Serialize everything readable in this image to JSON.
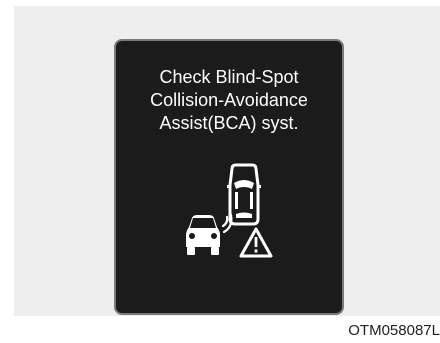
{
  "display": {
    "message_lines": [
      "Check Blind-Spot",
      "Collision-Avoidance",
      "Assist(BCA) syst."
    ],
    "icon": "blind-spot-collision-warning-icon",
    "colors": {
      "screen": "#1b1b1b",
      "bezel": "#7a7a7a",
      "text": "#ffffff"
    }
  },
  "figure_code": "OTM058087L"
}
